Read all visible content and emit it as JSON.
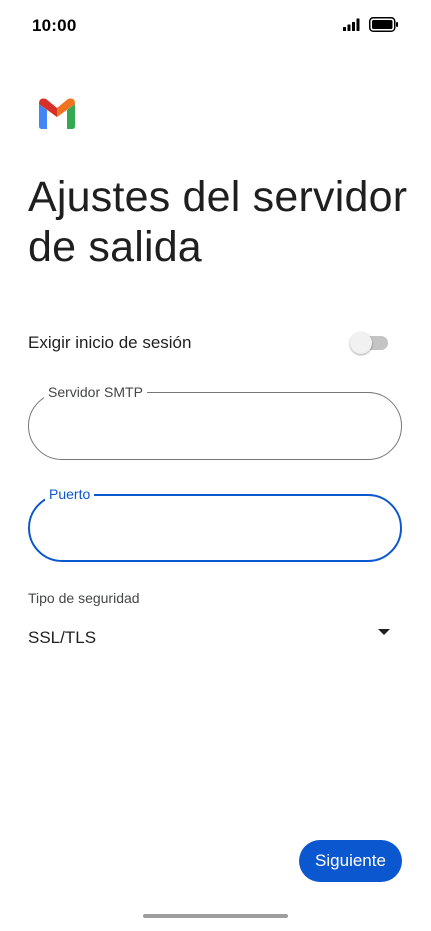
{
  "status_bar": {
    "time": "10:00",
    "icons": [
      "signal-icon",
      "battery-icon"
    ]
  },
  "app": {
    "logo": "gmail-logo-icon",
    "title": "Ajustes del servidor de salida"
  },
  "require_login": {
    "label": "Exigir inicio de sesión",
    "enabled": false
  },
  "smtp_server": {
    "label": "Servidor SMTP",
    "value": ""
  },
  "port": {
    "label": "Puerto",
    "value": "",
    "focused": true
  },
  "security": {
    "label": "Tipo de seguridad",
    "selected": "SSL/TLS"
  },
  "actions": {
    "next_label": "Siguiente"
  },
  "colors": {
    "accent": "#0b57d0",
    "text": "#1f1f1f",
    "outline": "#747775"
  }
}
